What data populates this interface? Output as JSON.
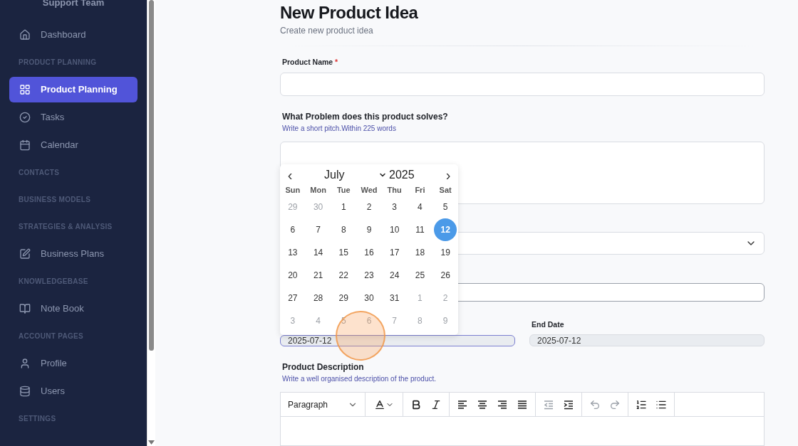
{
  "sidebar": {
    "team": "Support Team",
    "entries": [
      {
        "kind": "item",
        "label": "Dashboard",
        "selected": false
      },
      {
        "kind": "section",
        "label": "PRODUCT PLANNING"
      },
      {
        "kind": "item",
        "label": "Product Planning",
        "selected": true
      },
      {
        "kind": "item",
        "label": "Tasks",
        "selected": false
      },
      {
        "kind": "item",
        "label": "Calendar",
        "selected": false
      },
      {
        "kind": "section",
        "label": "CONTACTS"
      },
      {
        "kind": "section",
        "label": "BUSINESS MODELS"
      },
      {
        "kind": "section",
        "label": "STRATEGIES & ANALYSIS"
      },
      {
        "kind": "item",
        "label": "Business Plans",
        "selected": false
      },
      {
        "kind": "section",
        "label": "KNOWLEDGEBASE"
      },
      {
        "kind": "item",
        "label": "Note Book",
        "selected": false
      },
      {
        "kind": "section",
        "label": "ACCOUNT PAGES"
      },
      {
        "kind": "item",
        "label": "Profile",
        "selected": false
      },
      {
        "kind": "item",
        "label": "Users",
        "selected": false
      },
      {
        "kind": "section",
        "label": "SETTINGS"
      }
    ]
  },
  "page": {
    "title": "New Product Idea",
    "subtitle": "Create new product idea"
  },
  "form": {
    "product_name": {
      "label": "Product Name",
      "required_mark": "*"
    },
    "problem": {
      "label": "What Problem does this product solves?",
      "hint": "Write a short pitch.Within 225 words"
    },
    "start_date": {
      "value": "2025-07-12",
      "focused": true
    },
    "end_date": {
      "label": "End Date",
      "value": "2025-07-12"
    },
    "description": {
      "label": "Product Description",
      "hint": "Write a well organised description of the product."
    },
    "toolbar": {
      "block_format": "Paragraph",
      "buttons": [
        {
          "kind": "text-color",
          "disabled": false
        },
        {
          "kind": "bold",
          "disabled": false
        },
        {
          "kind": "italic",
          "disabled": false
        },
        {
          "kind": "align-left",
          "disabled": false
        },
        {
          "kind": "align-center",
          "disabled": false
        },
        {
          "kind": "align-right",
          "disabled": false
        },
        {
          "kind": "justify",
          "disabled": false
        },
        {
          "kind": "outdent",
          "disabled": true
        },
        {
          "kind": "indent",
          "disabled": false
        },
        {
          "kind": "undo",
          "disabled": true
        },
        {
          "kind": "redo",
          "disabled": true
        },
        {
          "kind": "ordered-list",
          "disabled": false
        },
        {
          "kind": "bullet-list",
          "disabled": false
        }
      ]
    }
  },
  "datepicker": {
    "month": "July",
    "year": "2025",
    "prev": "‹",
    "next": "›",
    "weekdays": [
      "Sun",
      "Mon",
      "Tue",
      "Wed",
      "Thu",
      "Fri",
      "Sat"
    ],
    "days": [
      {
        "label": "29",
        "outside": true,
        "selected": false
      },
      {
        "label": "30",
        "outside": true,
        "selected": false
      },
      {
        "label": "1",
        "outside": false,
        "selected": false
      },
      {
        "label": "2",
        "outside": false,
        "selected": false
      },
      {
        "label": "3",
        "outside": false,
        "selected": false
      },
      {
        "label": "4",
        "outside": false,
        "selected": false
      },
      {
        "label": "5",
        "outside": false,
        "selected": false
      },
      {
        "label": "6",
        "outside": false,
        "selected": false
      },
      {
        "label": "7",
        "outside": false,
        "selected": false
      },
      {
        "label": "8",
        "outside": false,
        "selected": false
      },
      {
        "label": "9",
        "outside": false,
        "selected": false
      },
      {
        "label": "10",
        "outside": false,
        "selected": false
      },
      {
        "label": "11",
        "outside": false,
        "selected": false
      },
      {
        "label": "12",
        "outside": false,
        "selected": true
      },
      {
        "label": "13",
        "outside": false,
        "selected": false
      },
      {
        "label": "14",
        "outside": false,
        "selected": false
      },
      {
        "label": "15",
        "outside": false,
        "selected": false
      },
      {
        "label": "16",
        "outside": false,
        "selected": false
      },
      {
        "label": "17",
        "outside": false,
        "selected": false
      },
      {
        "label": "18",
        "outside": false,
        "selected": false
      },
      {
        "label": "19",
        "outside": false,
        "selected": false
      },
      {
        "label": "20",
        "outside": false,
        "selected": false
      },
      {
        "label": "21",
        "outside": false,
        "selected": false
      },
      {
        "label": "22",
        "outside": false,
        "selected": false
      },
      {
        "label": "23",
        "outside": false,
        "selected": false
      },
      {
        "label": "24",
        "outside": false,
        "selected": false
      },
      {
        "label": "25",
        "outside": false,
        "selected": false
      },
      {
        "label": "26",
        "outside": false,
        "selected": false
      },
      {
        "label": "27",
        "outside": false,
        "selected": false
      },
      {
        "label": "28",
        "outside": false,
        "selected": false
      },
      {
        "label": "29",
        "outside": false,
        "selected": false
      },
      {
        "label": "30",
        "outside": false,
        "selected": false
      },
      {
        "label": "31",
        "outside": false,
        "selected": false
      },
      {
        "label": "1",
        "outside": true,
        "selected": false
      },
      {
        "label": "2",
        "outside": true,
        "selected": false
      },
      {
        "label": "3",
        "outside": true,
        "selected": false
      },
      {
        "label": "4",
        "outside": true,
        "selected": false
      },
      {
        "label": "5",
        "outside": true,
        "selected": false
      },
      {
        "label": "6",
        "outside": true,
        "selected": false
      },
      {
        "label": "7",
        "outside": true,
        "selected": false
      },
      {
        "label": "8",
        "outside": true,
        "selected": false
      },
      {
        "label": "9",
        "outside": true,
        "selected": false
      }
    ]
  },
  "click_marker": {
    "shown": true
  }
}
